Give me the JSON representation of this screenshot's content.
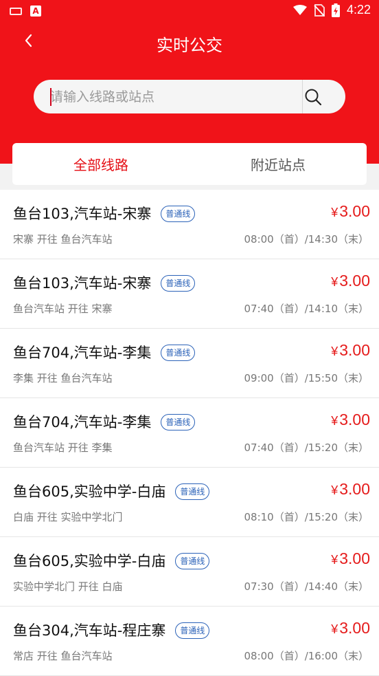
{
  "status_bar": {
    "time": "4:22",
    "app_icon": "A"
  },
  "header": {
    "title": "实时公交",
    "back_icon": "chevron-left-icon"
  },
  "search": {
    "placeholder": "请输入线路或站点",
    "value": ""
  },
  "tabs": [
    {
      "label": "全部线路",
      "active": true
    },
    {
      "label": "附近站点",
      "active": false
    }
  ],
  "colors": {
    "brand_red": "#f01319",
    "price_red": "#e51b1b",
    "badge_blue": "#2b62b8"
  },
  "routes": [
    {
      "name": "鱼台103,汽车站-宋寨",
      "badge": "普通线",
      "currency": "¥",
      "price": "3.00",
      "direction": "宋寨 开往 鱼台汽车站",
      "times": "08:00（首）/14:30（末）"
    },
    {
      "name": "鱼台103,汽车站-宋寨",
      "badge": "普通线",
      "currency": "¥",
      "price": "3.00",
      "direction": "鱼台汽车站 开往 宋寨",
      "times": "07:40（首）/14:10（末）"
    },
    {
      "name": "鱼台704,汽车站-李集",
      "badge": "普通线",
      "currency": "¥",
      "price": "3.00",
      "direction": "李集 开往 鱼台汽车站",
      "times": "09:00（首）/15:50（末）"
    },
    {
      "name": "鱼台704,汽车站-李集",
      "badge": "普通线",
      "currency": "¥",
      "price": "3.00",
      "direction": "鱼台汽车站 开往 李集",
      "times": "07:40（首）/15:20（末）"
    },
    {
      "name": "鱼台605,实验中学-白庙",
      "badge": "普通线",
      "currency": "¥",
      "price": "3.00",
      "direction": "白庙 开往 实验中学北门",
      "times": "08:10（首）/15:20（末）"
    },
    {
      "name": "鱼台605,实验中学-白庙",
      "badge": "普通线",
      "currency": "¥",
      "price": "3.00",
      "direction": "实验中学北门 开往 白庙",
      "times": "07:30（首）/14:40（末）"
    },
    {
      "name": "鱼台304,汽车站-程庄寨",
      "badge": "普通线",
      "currency": "¥",
      "price": "3.00",
      "direction": "常店 开往 鱼台汽车站",
      "times": "08:00（首）/16:00（末）"
    }
  ]
}
